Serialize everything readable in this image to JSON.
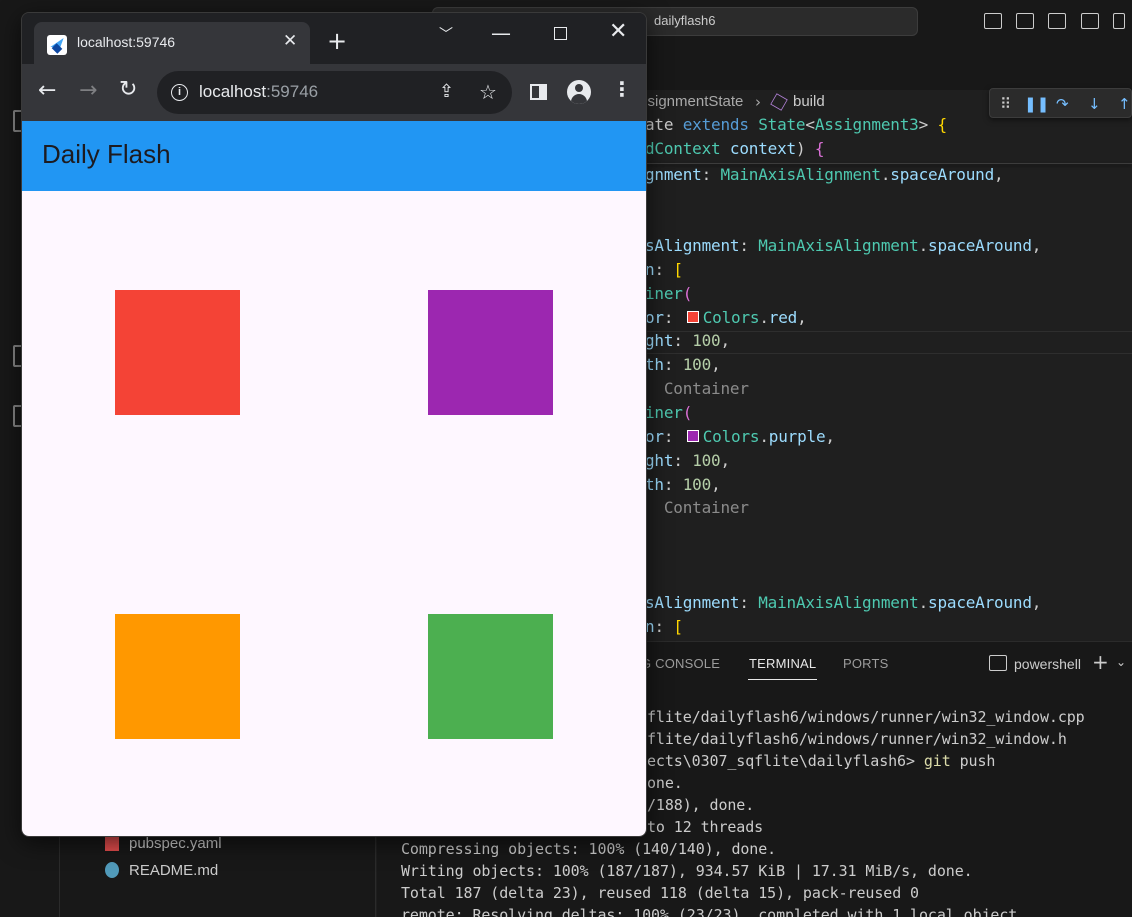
{
  "vscode": {
    "search_text": "dailyflash6",
    "breadcrumb": {
      "class_segment": "ssignmentState",
      "method_segment": "build"
    },
    "code_lines": [
      {
        "parts": [
          [
            "",
            "ate "
          ],
          [
            "kw",
            "extends "
          ],
          [
            "ty",
            "State"
          ],
          [
            "",
            "<"
          ],
          [
            "ty",
            "Assignment3"
          ],
          [
            "",
            "> "
          ],
          [
            "br",
            "{"
          ]
        ]
      },
      {
        "parts": [
          [
            "ty",
            "dContext "
          ],
          [
            "pr",
            "context"
          ],
          [
            "",
            ") "
          ],
          [
            "pk",
            "{"
          ]
        ]
      },
      {
        "parts": [
          [
            "pr",
            "gnment"
          ],
          [
            "",
            ": "
          ],
          [
            "ty",
            "MainAxisAlignment"
          ],
          [
            "",
            "."
          ],
          [
            "pr",
            "spaceAround"
          ],
          [
            "",
            ","
          ]
        ]
      },
      {
        "parts": [
          [
            "pr",
            "sAlignment"
          ],
          [
            "",
            ": "
          ],
          [
            "ty",
            "MainAxisAlignment"
          ],
          [
            "",
            "."
          ],
          [
            "pr",
            "spaceAround"
          ],
          [
            "",
            ","
          ]
        ]
      },
      {
        "parts": [
          [
            "pr",
            "n"
          ],
          [
            "",
            ": "
          ],
          [
            "br",
            "["
          ]
        ]
      },
      {
        "parts": [
          [
            "ty",
            "iner"
          ],
          [
            "pk",
            "("
          ]
        ]
      },
      {
        "parts": [
          [
            "pr",
            "or"
          ],
          [
            "",
            ": "
          ],
          [
            "swatch",
            "#f44336"
          ],
          [
            "ty",
            "Colors"
          ],
          [
            "",
            "."
          ],
          [
            "pr",
            "red"
          ],
          [
            "",
            ","
          ]
        ]
      },
      {
        "parts": [
          [
            "pr",
            "ght"
          ],
          [
            "",
            ": "
          ],
          [
            "nu",
            "100"
          ],
          [
            "",
            ","
          ]
        ]
      },
      {
        "parts": [
          [
            "pr",
            "th"
          ],
          [
            "",
            ": "
          ],
          [
            "nu",
            "100"
          ],
          [
            "",
            ","
          ]
        ]
      },
      {
        "parts": [
          [
            "cm",
            "  Container"
          ]
        ]
      },
      {
        "parts": [
          [
            "ty",
            "iner"
          ],
          [
            "pk",
            "("
          ]
        ]
      },
      {
        "parts": [
          [
            "pr",
            "or"
          ],
          [
            "",
            ": "
          ],
          [
            "swatch",
            "#9c27b0"
          ],
          [
            "ty",
            "Colors"
          ],
          [
            "",
            "."
          ],
          [
            "pr",
            "purple"
          ],
          [
            "",
            ","
          ]
        ]
      },
      {
        "parts": [
          [
            "pr",
            "ght"
          ],
          [
            "",
            ": "
          ],
          [
            "nu",
            "100"
          ],
          [
            "",
            ","
          ]
        ]
      },
      {
        "parts": [
          [
            "pr",
            "th"
          ],
          [
            "",
            ": "
          ],
          [
            "nu",
            "100"
          ],
          [
            "",
            ","
          ]
        ]
      },
      {
        "parts": [
          [
            "cm",
            "  Container"
          ]
        ]
      },
      {
        "parts": [
          [
            "pr",
            "sAlignment"
          ],
          [
            "",
            ": "
          ],
          [
            "ty",
            "MainAxisAlignment"
          ],
          [
            "",
            "."
          ],
          [
            "pr",
            "spaceAround"
          ],
          [
            "",
            ","
          ]
        ]
      },
      {
        "parts": [
          [
            "pr",
            "n"
          ],
          [
            "",
            ": "
          ],
          [
            "br",
            "["
          ]
        ]
      }
    ],
    "panel": {
      "tabs": [
        "G CONSOLE",
        "TERMINAL",
        "PORTS"
      ],
      "active_tab": "TERMINAL",
      "shell_label": "powershell",
      "lines": [
        "flite/dailyflash6/windows/runner/win32_window.cpp",
        "flite/dailyflash6/windows/runner/win32_window.h",
        "ects\\0307_sqflite\\dailyflash6> git push",
        "one.",
        "/188), done.",
        "to 12 threads",
        "Compressing objects: 100% (140/140), done.",
        "Writing objects: 100% (187/187), 934.57 KiB | 17.31 MiB/s, done.",
        "Total 187 (delta 23), reused 118 (delta 15), pack-reused 0",
        "remote: Resolving deltas: 100% (23/23), completed with 1 local object."
      ]
    },
    "explorer_files": [
      {
        "name": "pubspec.yaml",
        "icon": "yaml-file-icon",
        "color": "#e44d4d"
      },
      {
        "name": "README.md",
        "icon": "info-file-icon",
        "color": "#519aba"
      }
    ]
  },
  "browser": {
    "tab_title": "localhost:59746",
    "url_host": "localhost",
    "url_port": ":59746",
    "close_glyph": "✕",
    "new_tab_glyph": "+"
  },
  "app": {
    "title": "Daily Flash",
    "appbar_color": "#2196f3",
    "background_color": "#fef7ff",
    "boxes": [
      {
        "name": "red-container",
        "color": "#f44336"
      },
      {
        "name": "purple-container",
        "color": "#9c27b0"
      },
      {
        "name": "orange-container",
        "color": "#ff9800"
      },
      {
        "name": "green-container",
        "color": "#4caf50"
      }
    ]
  }
}
